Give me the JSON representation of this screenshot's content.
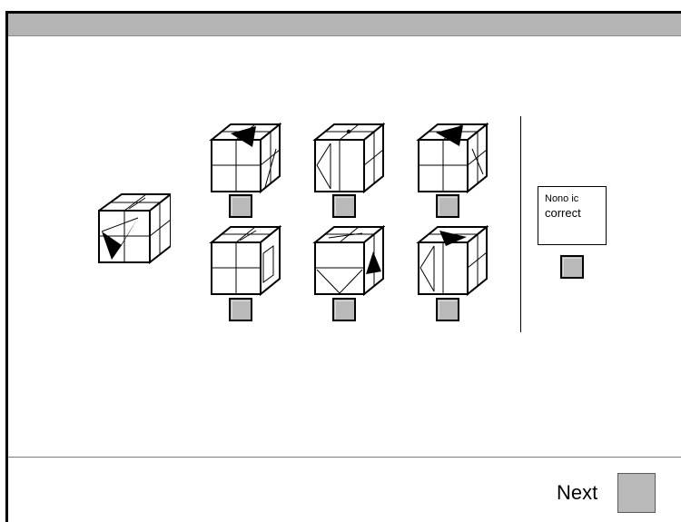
{
  "answer_box": {
    "line1": "Nono ic",
    "line2": "correct"
  },
  "footer": {
    "next_label": "Next"
  },
  "colors": {
    "titlebar": "#b4b4b4",
    "button": "#b9b9b9"
  },
  "icons": {
    "reference": "reference-cube-icon",
    "options": [
      "option-cube-1-icon",
      "option-cube-2-icon",
      "option-cube-3-icon",
      "option-cube-4-icon",
      "option-cube-5-icon",
      "option-cube-6-icon"
    ]
  }
}
